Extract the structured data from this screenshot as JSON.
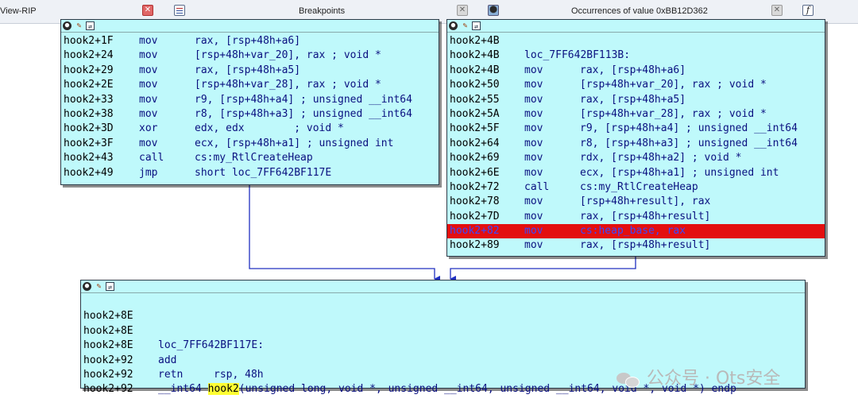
{
  "tabs": [
    {
      "label": "View-RIP"
    },
    {
      "label": "Breakpoints"
    },
    {
      "label": "Occurrences of value 0xBB12D362"
    }
  ],
  "icons": {
    "close_tab": "close-icon",
    "breakpoints": "breakpoints-icon",
    "occurrences": "search-occurrences-icon",
    "functions": "function-icon",
    "node_header": [
      "graph-node-color-icon",
      "edit-node-icon",
      "group-node-icon"
    ]
  },
  "colors": {
    "node_background": "#bff9fb",
    "highlight_row": "#e30f0f",
    "edge": "#2030c0",
    "arrow_annotation": "#e02020",
    "symbol_highlight": "#ffff33"
  },
  "graph": {
    "block_left": [
      {
        "addr": "hook2+1F",
        "mn": "mov",
        "op": "rax, [rsp+48h+a6]"
      },
      {
        "addr": "hook2+24",
        "mn": "mov",
        "op": "[rsp+48h+var_20], rax ; void *"
      },
      {
        "addr": "hook2+29",
        "mn": "mov",
        "op": "rax, [rsp+48h+a5]"
      },
      {
        "addr": "hook2+2E",
        "mn": "mov",
        "op": "[rsp+48h+var_28], rax ; void *"
      },
      {
        "addr": "hook2+33",
        "mn": "mov",
        "op": "r9, [rsp+48h+a4] ; unsigned __int64"
      },
      {
        "addr": "hook2+38",
        "mn": "mov",
        "op": "r8, [rsp+48h+a3] ; unsigned __int64"
      },
      {
        "addr": "hook2+3D",
        "mn": "xor",
        "op": "edx, edx        ; void *"
      },
      {
        "addr": "hook2+3F",
        "mn": "mov",
        "op": "ecx, [rsp+48h+a1] ; unsigned int"
      },
      {
        "addr": "hook2+43",
        "mn": "call",
        "op": "cs:my_RtlCreateHeap"
      },
      {
        "addr": "hook2+49",
        "mn": "jmp",
        "op": "short loc_7FF642BF117E"
      }
    ],
    "block_right": [
      {
        "addr": "hook2+4B",
        "mn": "",
        "op": ""
      },
      {
        "addr": "hook2+4B",
        "mn": "loc_7FF642BF113B:",
        "op": ""
      },
      {
        "addr": "hook2+4B",
        "mn": "mov",
        "op": "rax, [rsp+48h+a6]"
      },
      {
        "addr": "hook2+50",
        "mn": "mov",
        "op": "[rsp+48h+var_20], rax ; void *"
      },
      {
        "addr": "hook2+55",
        "mn": "mov",
        "op": "rax, [rsp+48h+a5]"
      },
      {
        "addr": "hook2+5A",
        "mn": "mov",
        "op": "[rsp+48h+var_28], rax ; void *"
      },
      {
        "addr": "hook2+5F",
        "mn": "mov",
        "op": "r9, [rsp+48h+a4] ; unsigned __int64"
      },
      {
        "addr": "hook2+64",
        "mn": "mov",
        "op": "r8, [rsp+48h+a3] ; unsigned __int64"
      },
      {
        "addr": "hook2+69",
        "mn": "mov",
        "op": "rdx, [rsp+48h+a2] ; void *"
      },
      {
        "addr": "hook2+6E",
        "mn": "mov",
        "op": "ecx, [rsp+48h+a1] ; unsigned int"
      },
      {
        "addr": "hook2+72",
        "mn": "call",
        "op": "cs:my_RtlCreateHeap"
      },
      {
        "addr": "hook2+78",
        "mn": "mov",
        "op": "[rsp+48h+result], rax"
      },
      {
        "addr": "hook2+7D",
        "mn": "mov",
        "op": "rax, [rsp+48h+result]"
      },
      {
        "addr": "hook2+82",
        "mn": "mov",
        "op": "cs:heap_base, rax",
        "highlighted": true
      },
      {
        "addr": "hook2+89",
        "mn": "mov",
        "op": "rax, [rsp+48h+result]"
      }
    ],
    "block_bottom": {
      "r0": {
        "addr": "hook2+8E"
      },
      "r1": {
        "addr": "hook2+8E",
        "label": "loc_7FF642BF117E:"
      },
      "r2": {
        "addr": "hook2+8E",
        "mn": "add",
        "op": "rsp, 48h"
      },
      "r3": {
        "addr": "hook2+92",
        "mn": "retn"
      },
      "r4": {
        "addr": "hook2+92",
        "pre": "__int64 ",
        "name": "hook2",
        "post": "(unsigned long, void *, unsigned __int64, unsigned __int64, void *, void *) endp"
      },
      "r5": {
        "addr": "hook2+92"
      }
    }
  },
  "watermark": "公众号 · Ots安全"
}
